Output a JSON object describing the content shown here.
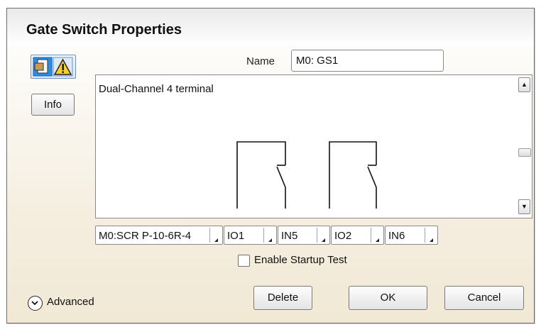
{
  "dialog": {
    "title": "Gate Switch Properties"
  },
  "icons": {
    "mode": "door-warning-icon"
  },
  "info_button": {
    "label": "Info"
  },
  "name": {
    "label": "Name",
    "value": "M0: GS1"
  },
  "diagram": {
    "title": "Dual-Channel 4 terminal"
  },
  "dropdowns": [
    {
      "value": "M0:SCR P-10-6R-4"
    },
    {
      "value": "IO1"
    },
    {
      "value": "IN5"
    },
    {
      "value": "IO2"
    },
    {
      "value": "IN6"
    }
  ],
  "startup_test": {
    "label": "Enable Startup Test",
    "checked": false
  },
  "advanced": {
    "label": "Advanced"
  },
  "buttons": {
    "delete": "Delete",
    "ok": "OK",
    "cancel": "Cancel"
  }
}
